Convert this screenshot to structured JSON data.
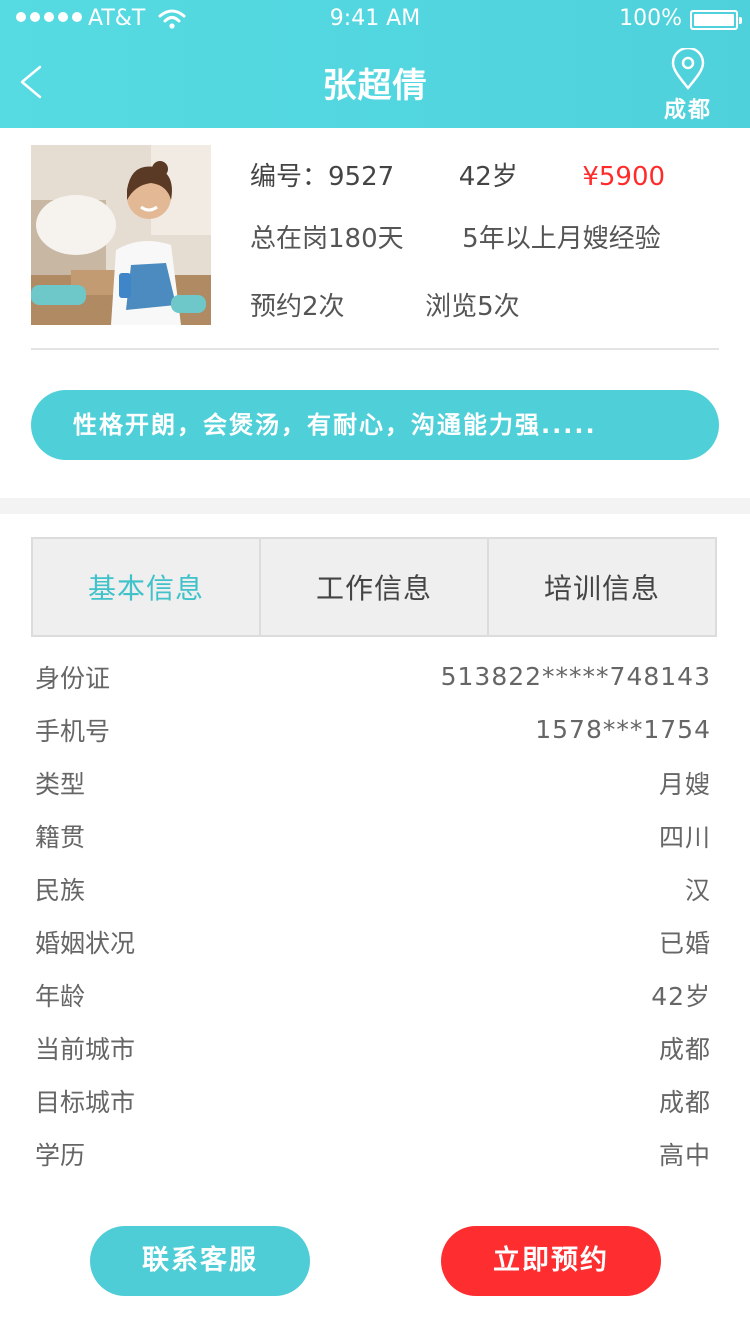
{
  "status_bar": {
    "carrier": "AT&T",
    "time": "9:41 AM",
    "battery": "100%"
  },
  "nav": {
    "title": "张超倩",
    "city": "成都"
  },
  "profile": {
    "number_label": "编号：9527",
    "age": "42岁",
    "price": "¥5900",
    "days_on_post": "总在岗180天",
    "experience": "5年以上月嫂经验",
    "bookings": "预约2次",
    "views": "浏览5次"
  },
  "tagline": "性格开朗，会煲汤，有耐心，沟通能力强.....",
  "tabs": [
    {
      "label": "基本信息",
      "active": true
    },
    {
      "label": "工作信息",
      "active": false
    },
    {
      "label": "培训信息",
      "active": false
    }
  ],
  "details": [
    {
      "label": "身份证",
      "value": "513822*****748143"
    },
    {
      "label": "手机号",
      "value": "1578***1754"
    },
    {
      "label": "类型",
      "value": "月嫂"
    },
    {
      "label": "籍贯",
      "value": "四川"
    },
    {
      "label": "民族",
      "value": "汉"
    },
    {
      "label": "婚姻状况",
      "value": "已婚"
    },
    {
      "label": "年龄",
      "value": "42岁"
    },
    {
      "label": "当前城市",
      "value": "成都"
    },
    {
      "label": "目标城市",
      "value": "成都"
    },
    {
      "label": "学历",
      "value": "高中"
    }
  ],
  "actions": {
    "contact_service": "联系客服",
    "book_now": "立即预约"
  },
  "colors": {
    "accent": "#4fd0d8",
    "price": "#ff2b2b",
    "book_button": "#fe2d30"
  },
  "icons": [
    "signal-dots-icon",
    "wifi-icon",
    "battery-icon",
    "back-arrow-icon",
    "location-pin-icon"
  ]
}
